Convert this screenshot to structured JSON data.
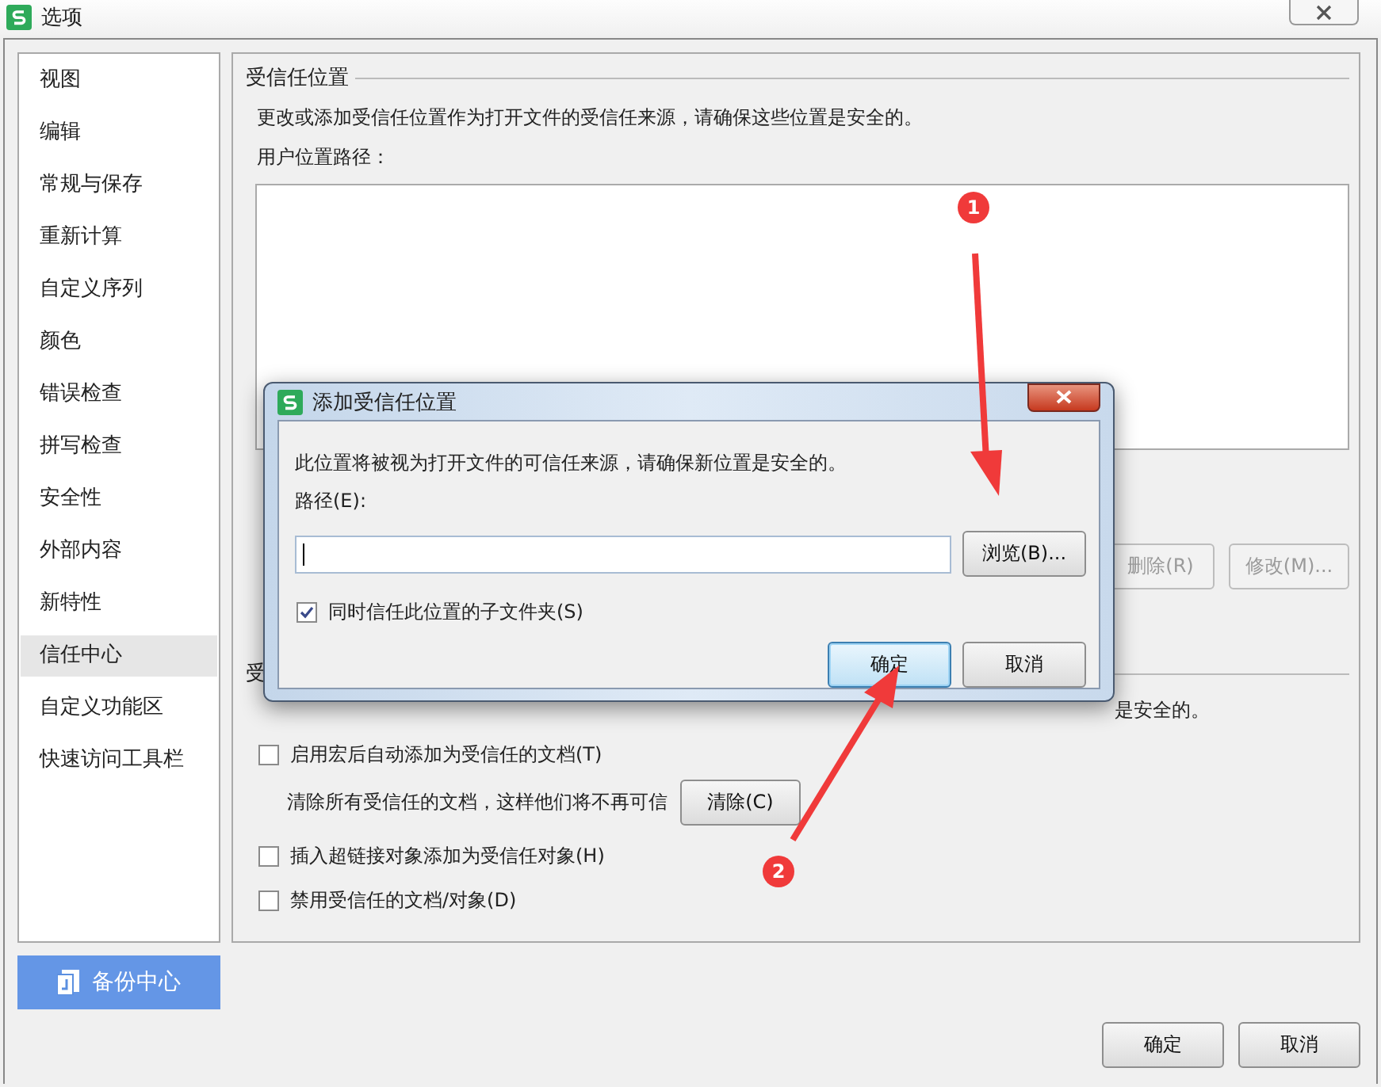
{
  "window": {
    "title": "选项"
  },
  "sidebar": {
    "items": [
      {
        "label": "视图",
        "selected": false
      },
      {
        "label": "编辑",
        "selected": false
      },
      {
        "label": "常规与保存",
        "selected": false
      },
      {
        "label": "重新计算",
        "selected": false
      },
      {
        "label": "自定义序列",
        "selected": false
      },
      {
        "label": "颜色",
        "selected": false
      },
      {
        "label": "错误检查",
        "selected": false
      },
      {
        "label": "拼写检查",
        "selected": false
      },
      {
        "label": "安全性",
        "selected": false
      },
      {
        "label": "外部内容",
        "selected": false
      },
      {
        "label": "新特性",
        "selected": false
      },
      {
        "label": "信任中心",
        "selected": true
      },
      {
        "label": "自定义功能区",
        "selected": false
      },
      {
        "label": "快速访问工具栏",
        "selected": false
      }
    ],
    "backup_button": "备份中心"
  },
  "trusted_locations": {
    "heading": "受信任位置",
    "description": "更改或添加受信任位置作为打开文件的受信任来源，请确保这些位置是安全的。",
    "path_label": "用户位置路径：",
    "buttons": [
      {
        "label": "删除(R)",
        "disabled": true
      },
      {
        "label": "修改(M)...",
        "disabled": true
      }
    ]
  },
  "trusted_documents": {
    "heading": "受",
    "description": "是安全的。",
    "options": [
      {
        "kind": "checkbox",
        "label": "启用宏后自动添加为受信任的文档(T)",
        "checked": false
      },
      {
        "kind": "action",
        "label": "清除所有受信任的文档，这样他们将不再可信",
        "button": "清除(C)"
      },
      {
        "kind": "checkbox",
        "label": "插入超链接对象添加为受信任对象(H)",
        "checked": false
      },
      {
        "kind": "checkbox",
        "label": "禁用受信任的文档/对象(D)",
        "checked": false
      }
    ]
  },
  "footer_buttons": [
    {
      "label": "确定"
    },
    {
      "label": "取消"
    }
  ],
  "dialog": {
    "title": "添加受信任位置",
    "description": "此位置将被视为打开文件的可信任来源，请确保新位置是安全的。",
    "path_label": "路径(E):",
    "browse_button": "浏览(B)...",
    "subfolders": {
      "label": "同时信任此位置的子文件夹(S)",
      "checked": true
    },
    "buttons": [
      {
        "label": "确定",
        "default": true
      },
      {
        "label": "取消",
        "default": false
      }
    ]
  },
  "annotations": [
    {
      "label": "1"
    },
    {
      "label": "2"
    }
  ]
}
